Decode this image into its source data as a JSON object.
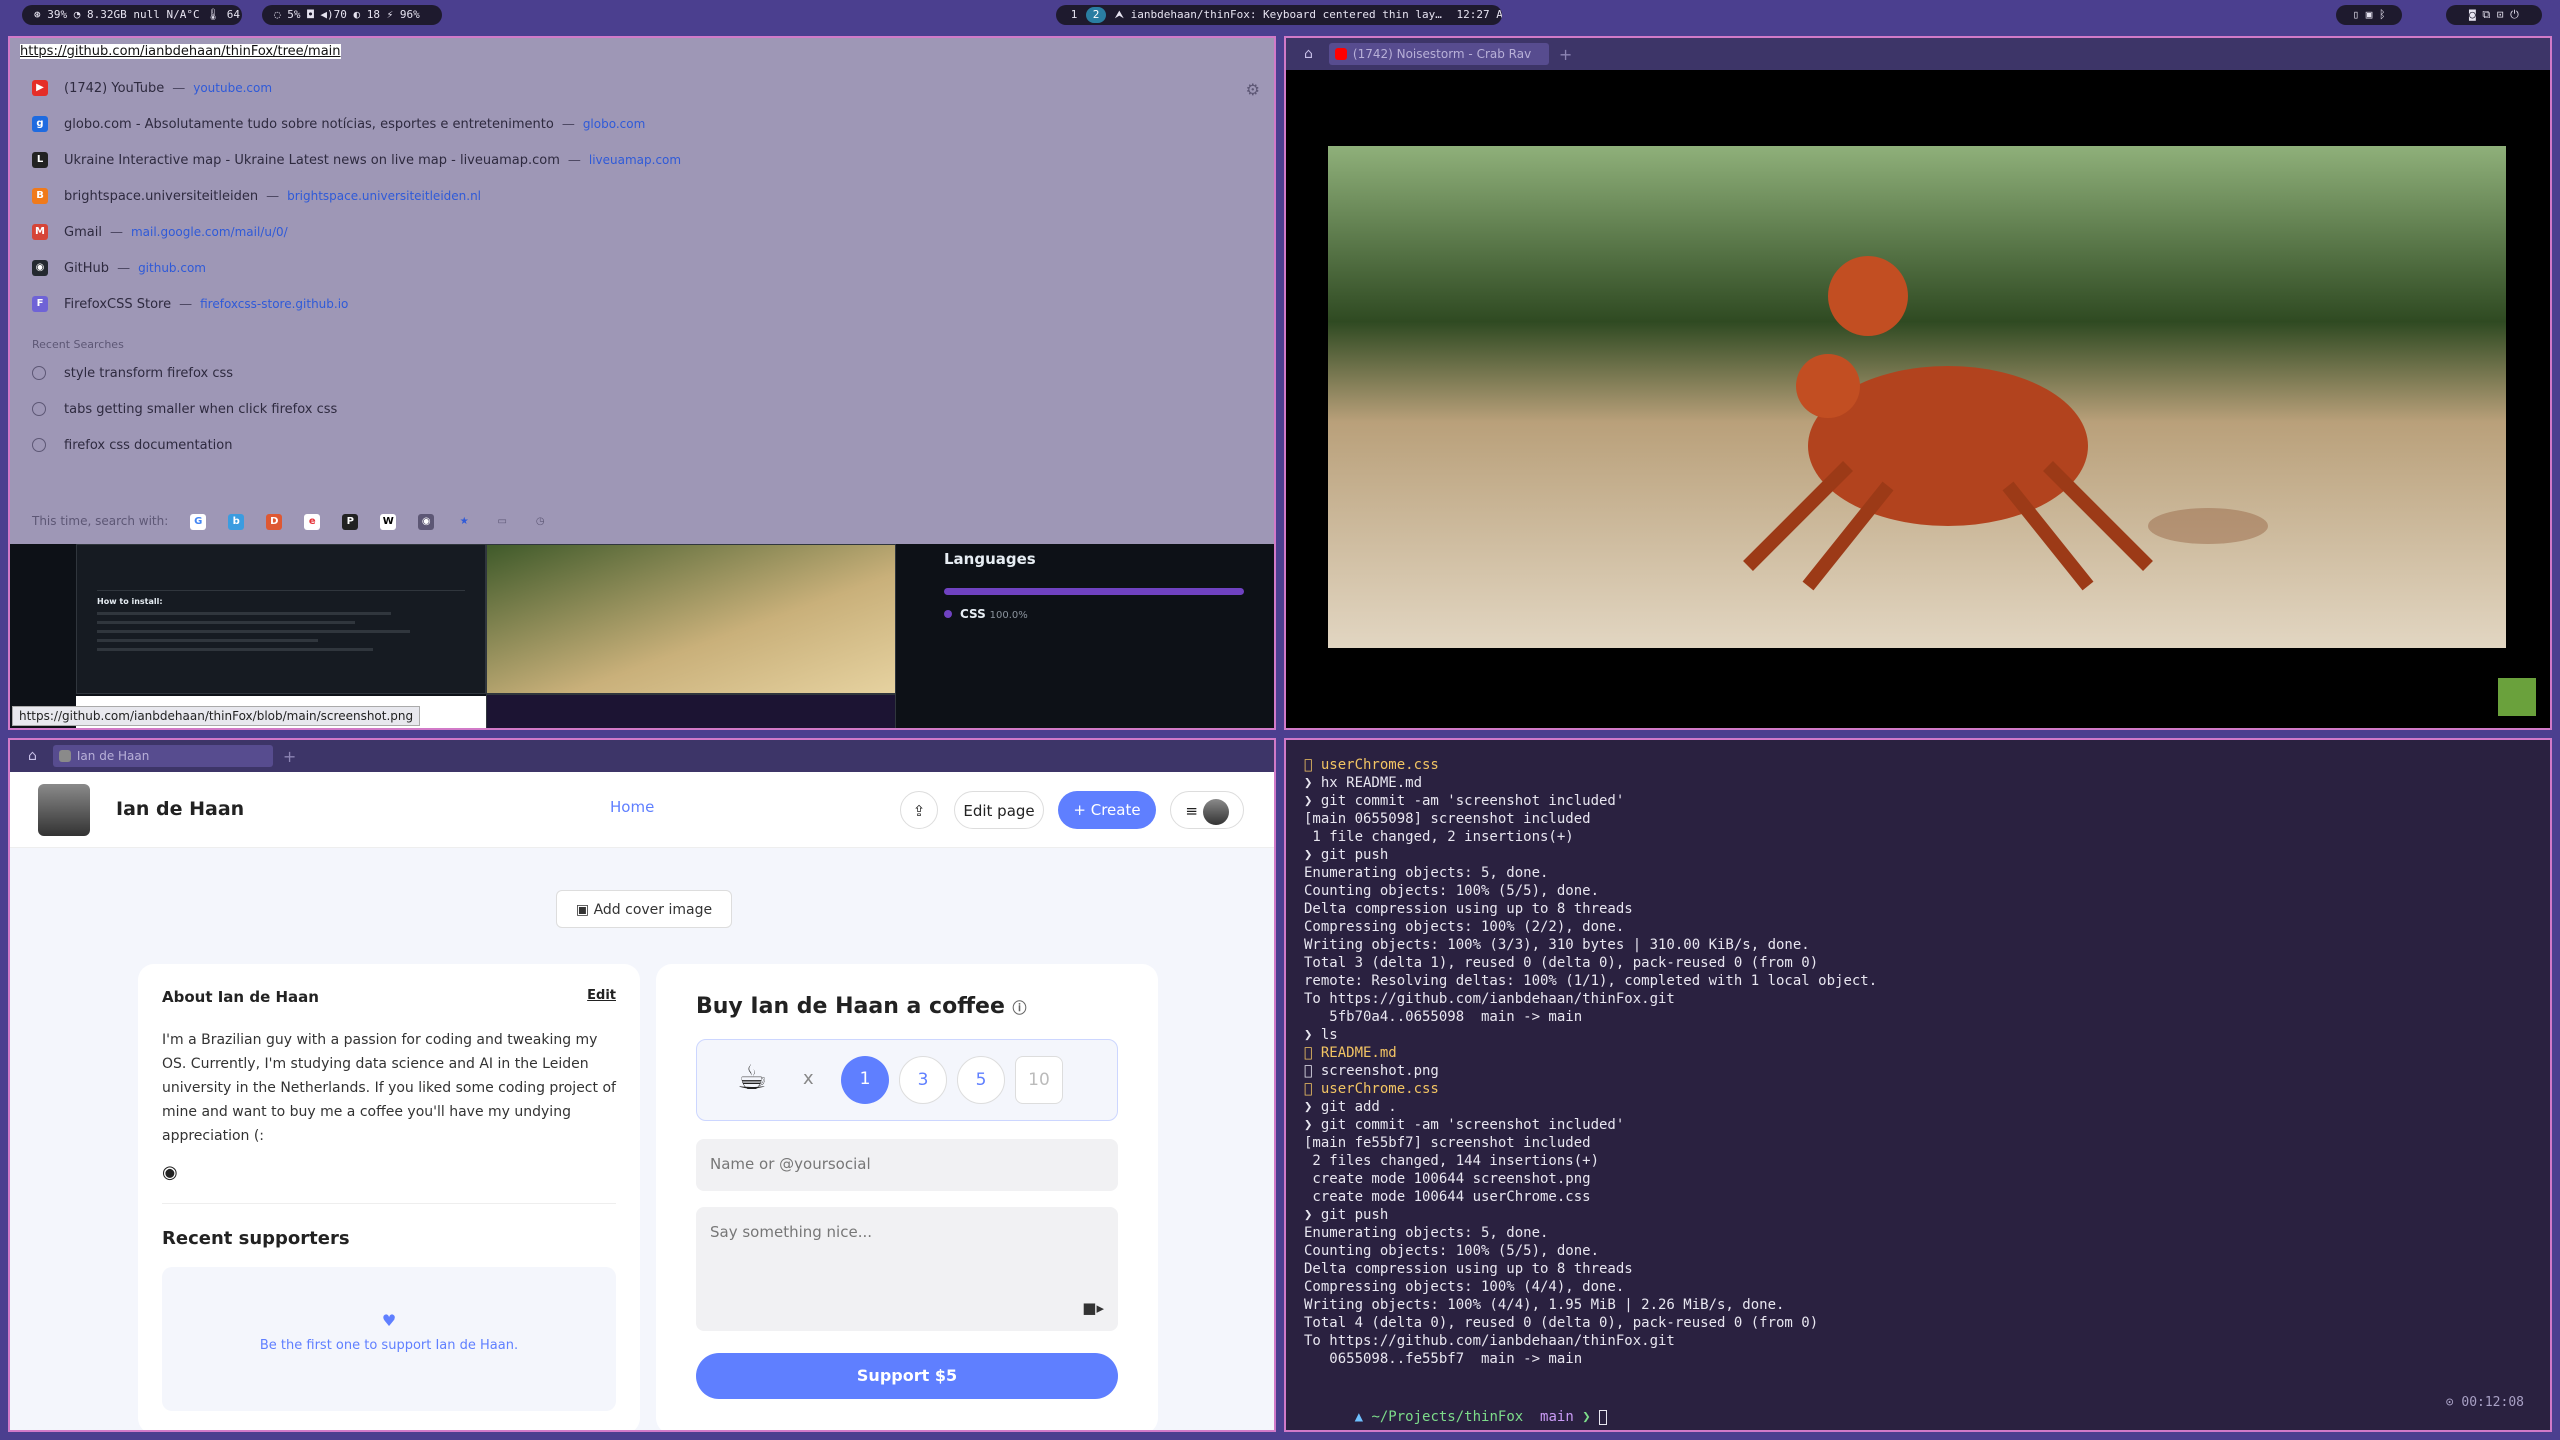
{
  "bar": {
    "left_status": "⊛ 39%  ◔ 8.32GB  null N/A°C  🌡 64°C",
    "mid_status": "◌ 5%  ◘  ◀)70  ◐ 18  ⚡ 96%",
    "workspaces": [
      "1",
      "2"
    ],
    "active_workspace": "2",
    "window_title": "ianbdehaan/thinFox: Keyboard centered thin lay…",
    "clock": "12:27 AM",
    "right_icons": [
      "phone-icon",
      "monitor-icon",
      "bluetooth-icon"
    ],
    "far_right_icons": [
      "camera-icon",
      "screenshot-icon",
      "lock-icon",
      "power-icon"
    ]
  },
  "firefox_main": {
    "url": "https://github.com/ianbdehaan/thinFox/tree/main",
    "suggestions": [
      {
        "title": "(1742) YouTube",
        "domain": "youtube.com",
        "icon": "youtube-icon",
        "color": "#e52d27",
        "glyph": "▶"
      },
      {
        "title": "globo.com - Absolutamente tudo sobre notícias, esportes e entretenimento",
        "domain": "globo.com",
        "icon": "globo-icon",
        "color": "#1f6be0",
        "glyph": "g"
      },
      {
        "title": "Ukraine Interactive map - Ukraine Latest news on live map - liveuamap.com",
        "domain": "liveuamap.com",
        "icon": "liveuamap-icon",
        "color": "#222222",
        "glyph": "L"
      },
      {
        "title": "brightspace.universiteitleiden",
        "domain": "brightspace.universiteitleiden.nl",
        "icon": "brightspace-icon",
        "color": "#f07a1a",
        "glyph": "B"
      },
      {
        "title": "Gmail",
        "domain": "mail.google.com/mail/u/0/",
        "icon": "gmail-icon",
        "color": "#d64537",
        "glyph": "M"
      },
      {
        "title": "GitHub",
        "domain": "github.com",
        "icon": "github-icon",
        "color": "#24292f",
        "glyph": "◉"
      },
      {
        "title": "FirefoxCSS Store",
        "domain": "firefoxcss-store.github.io",
        "icon": "firefoxcss-icon",
        "color": "#6f63d6",
        "glyph": "F"
      }
    ],
    "recent_searches_label": "Recent Searches",
    "recent_searches": [
      "style transform firefox css",
      "tabs getting smaller when click firefox css",
      "firefox css documentation"
    ],
    "search_with_label": "This time, search with:",
    "engines": [
      {
        "name": "google-icon",
        "color": "#ffffff",
        "glyph": "G",
        "fg": "#4285f4"
      },
      {
        "name": "bing-icon",
        "color": "#3b9ce0",
        "glyph": "b",
        "fg": "#ffffff"
      },
      {
        "name": "duckduckgo-icon",
        "color": "#de5833",
        "glyph": "D",
        "fg": "#ffffff"
      },
      {
        "name": "ebay-icon",
        "color": "#ffffff",
        "glyph": "e",
        "fg": "#e53238"
      },
      {
        "name": "perplexity-icon",
        "color": "#222222",
        "glyph": "P",
        "fg": "#ffffff"
      },
      {
        "name": "wikipedia-icon",
        "color": "#ffffff",
        "glyph": "W",
        "fg": "#000000"
      },
      {
        "name": "extension-icon",
        "color": "#5d5775",
        "glyph": "◉",
        "fg": "#ffffff"
      },
      {
        "name": "bookmarks-icon",
        "color": "#9e97b6",
        "glyph": "★",
        "fg": "#2f5ad8"
      },
      {
        "name": "tabs-icon",
        "color": "#9e97b6",
        "glyph": "▭",
        "fg": "#5d5775"
      },
      {
        "name": "history-icon",
        "color": "#9e97b6",
        "glyph": "◷",
        "fg": "#5d5775"
      }
    ],
    "languages_title": "Languages",
    "language_name": "CSS",
    "language_pct": "100.0%",
    "readme_heading": "How to install:",
    "hover_url": "https://github.com/ianbdehaan/thinFox/blob/main/screenshot.png"
  },
  "youtube_window": {
    "tab_title": "(1742) Noisestorm - Crab Rav"
  },
  "bmc_window": {
    "tab_title": "Ian de Haan",
    "profile_name": "Ian de Haan",
    "nav_home": "Home",
    "edit_page": "Edit page",
    "create": "+ Create",
    "add_cover": "Add cover image",
    "about_title": "About Ian de Haan",
    "about_edit": "Edit",
    "about_text": "I'm a Brazilian guy with a passion for coding and tweaking my OS. Currently, I'm studying data science and AI in the Leiden university in the Netherlands. If you liked some coding project of mine and want to buy me a coffee you'll have my undying appreciation (:",
    "recent_supporters": "Recent supporters",
    "first_support": "Be the first one to support Ian de Haan.",
    "buy_title": "Buy Ian de Haan a coffee",
    "multiplier": "x",
    "amounts": [
      "1",
      "3",
      "5",
      "10"
    ],
    "selected_amount": "1",
    "name_placeholder": "Name or @yoursocial",
    "message_placeholder": "Say something nice...",
    "support_button": "Support $5"
  },
  "terminal": {
    "lines": [
      {
        "t": "󰈙 userChrome.css",
        "c": "yel"
      },
      {
        "t": "❯ hx README.md",
        "c": ""
      },
      {
        "t": "❯ git commit -am 'screenshot included'",
        "c": ""
      },
      {
        "t": "[main 0655098] screenshot included",
        "c": ""
      },
      {
        "t": " 1 file changed, 2 insertions(+)",
        "c": ""
      },
      {
        "t": "❯ git push",
        "c": ""
      },
      {
        "t": "Enumerating objects: 5, done.",
        "c": ""
      },
      {
        "t": "Counting objects: 100% (5/5), done.",
        "c": ""
      },
      {
        "t": "Delta compression using up to 8 threads",
        "c": ""
      },
      {
        "t": "Compressing objects: 100% (2/2), done.",
        "c": ""
      },
      {
        "t": "Writing objects: 100% (3/3), 310 bytes | 310.00 KiB/s, done.",
        "c": ""
      },
      {
        "t": "Total 3 (delta 1), reused 0 (delta 0), pack-reused 0 (from 0)",
        "c": ""
      },
      {
        "t": "remote: Resolving deltas: 100% (1/1), completed with 1 local object.",
        "c": ""
      },
      {
        "t": "To https://github.com/ianbdehaan/thinFox.git",
        "c": ""
      },
      {
        "t": "   5fb70a4..0655098  main -> main",
        "c": ""
      },
      {
        "t": "❯ ls",
        "c": ""
      },
      {
        "t": "󰂺 README.md",
        "c": "yel"
      },
      {
        "t": "󰋩 screenshot.png",
        "c": ""
      },
      {
        "t": "󰈙 userChrome.css",
        "c": "yel"
      },
      {
        "t": "❯ git add .",
        "c": ""
      },
      {
        "t": "❯ git commit -am 'screenshot included'",
        "c": ""
      },
      {
        "t": "[main fe55bf7] screenshot included",
        "c": ""
      },
      {
        "t": " 2 files changed, 144 insertions(+)",
        "c": ""
      },
      {
        "t": " create mode 100644 screenshot.png",
        "c": ""
      },
      {
        "t": " create mode 100644 userChrome.css",
        "c": ""
      },
      {
        "t": "❯ git push",
        "c": ""
      },
      {
        "t": "Enumerating objects: 5, done.",
        "c": ""
      },
      {
        "t": "Counting objects: 100% (5/5), done.",
        "c": ""
      },
      {
        "t": "Delta compression using up to 8 threads",
        "c": ""
      },
      {
        "t": "Compressing objects: 100% (4/4), done.",
        "c": ""
      },
      {
        "t": "Writing objects: 100% (4/4), 1.95 MiB | 2.26 MiB/s, done.",
        "c": ""
      },
      {
        "t": "Total 4 (delta 0), reused 0 (delta 0), pack-reused 0 (from 0)",
        "c": ""
      },
      {
        "t": "To https://github.com/ianbdehaan/thinFox.git",
        "c": ""
      },
      {
        "t": "   0655098..fe55bf7  main -> main",
        "c": ""
      }
    ],
    "prompt_path": "~/Projects/thinFox",
    "prompt_branch": "main",
    "duration": "⊙ 00:12:08"
  }
}
